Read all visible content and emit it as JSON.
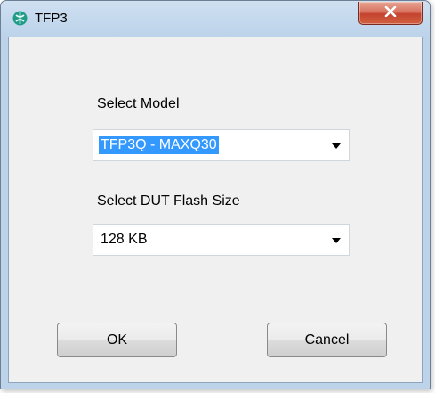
{
  "window": {
    "title": "TFP3",
    "icon": "tfp3-app-icon",
    "close_icon": "close-x-icon",
    "close_color": "#c4432f"
  },
  "form": {
    "model_label": "Select Model",
    "model_value": "TFP3Q - MAXQ30",
    "flash_label": "Select DUT Flash Size",
    "flash_value": "128 KB"
  },
  "buttons": {
    "ok": "OK",
    "cancel": "Cancel"
  },
  "colors": {
    "titlebar": "#bcd3ea",
    "selection": "#3399ff"
  }
}
